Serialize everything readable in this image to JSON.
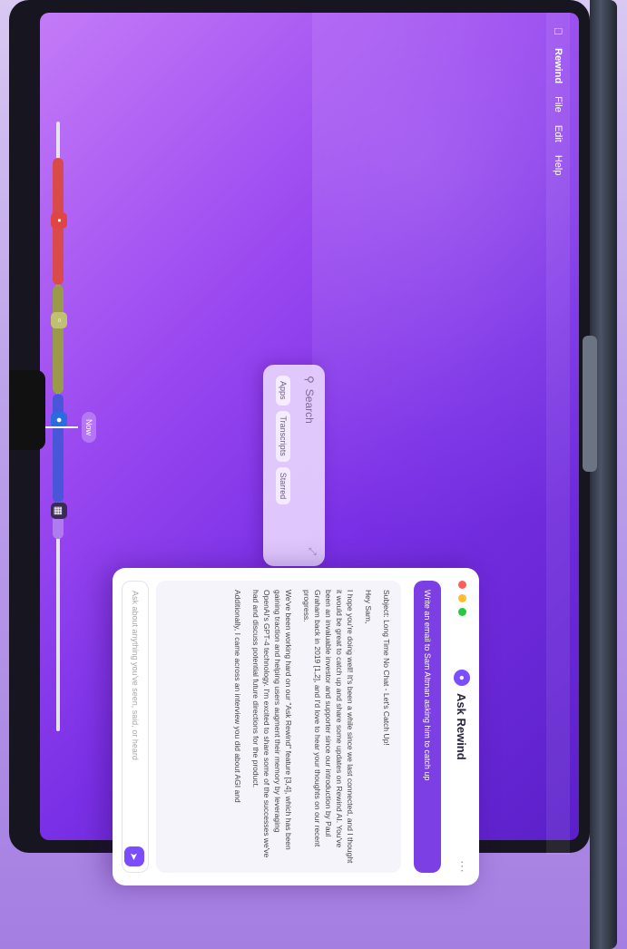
{
  "menubar": {
    "app": "Rewind",
    "items": [
      "File",
      "Edit",
      "Help"
    ]
  },
  "search": {
    "placeholder": "Search",
    "chips": [
      "Apps",
      "Transcripts",
      "Starred"
    ]
  },
  "timeline": {
    "now_label": "Now"
  },
  "ask": {
    "title": "Ask Rewind",
    "prompt": "Write an email to Sam Altman asking him to catch up",
    "email": {
      "subject": "Subject: Long Time No Chat - Let's Catch Up!",
      "greeting": "Hey Sam,",
      "p1": "I hope you're doing well! It's been a while since we last connected, and I thought it would be great to catch up and share some updates on Rewind AI. You've been an invaluable investor and supporter since our introduction by Paul Graham back in 2019 [1,2], and I'd love to hear your thoughts on our recent progress.",
      "p2": "We've been working hard on our \"Ask Rewind\" feature [3,4], which has been gaining traction and helping users augment their memory by leveraging OpenAI's GPT-4 technology. I'm excited to share some of the successes we've had and discuss potential future directions for the product.",
      "p3": "Additionally, I came across an interview you did about AGI and"
    },
    "input_placeholder": "Ask about anything you've seen, said, or heard"
  },
  "colors": {
    "accent": "#7c4dff",
    "prompt_bg": "#7b3fe4"
  }
}
